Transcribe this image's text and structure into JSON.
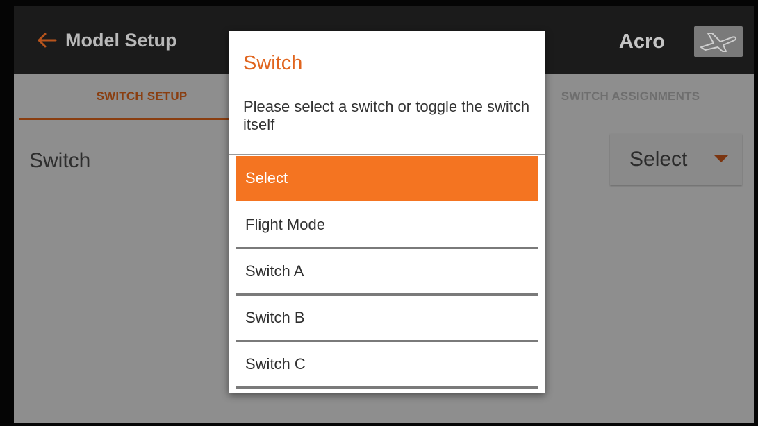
{
  "header": {
    "title": "Model Setup",
    "model_name": "Acro",
    "back_icon": "left-arrow-icon",
    "model_icon": "airplane-icon"
  },
  "tabs": [
    {
      "label": "SWITCH SETUP",
      "active": true
    },
    {
      "label": "SWITCH ASSIGNMENTS",
      "active": false
    }
  ],
  "main": {
    "field_label": "Switch",
    "select_value": "Select"
  },
  "dialog": {
    "title": "Switch",
    "message": "Please select a switch or toggle the switch itself",
    "options": [
      {
        "label": "Select",
        "selected": true
      },
      {
        "label": "Flight Mode",
        "selected": false
      },
      {
        "label": "Switch A",
        "selected": false
      },
      {
        "label": "Switch B",
        "selected": false
      },
      {
        "label": "Switch C",
        "selected": false
      }
    ]
  },
  "colors": {
    "accent": "#f47421",
    "title_accent": "#e0651f",
    "header_bg": "#1b1b1b",
    "scrim": "#8e8e8e"
  }
}
